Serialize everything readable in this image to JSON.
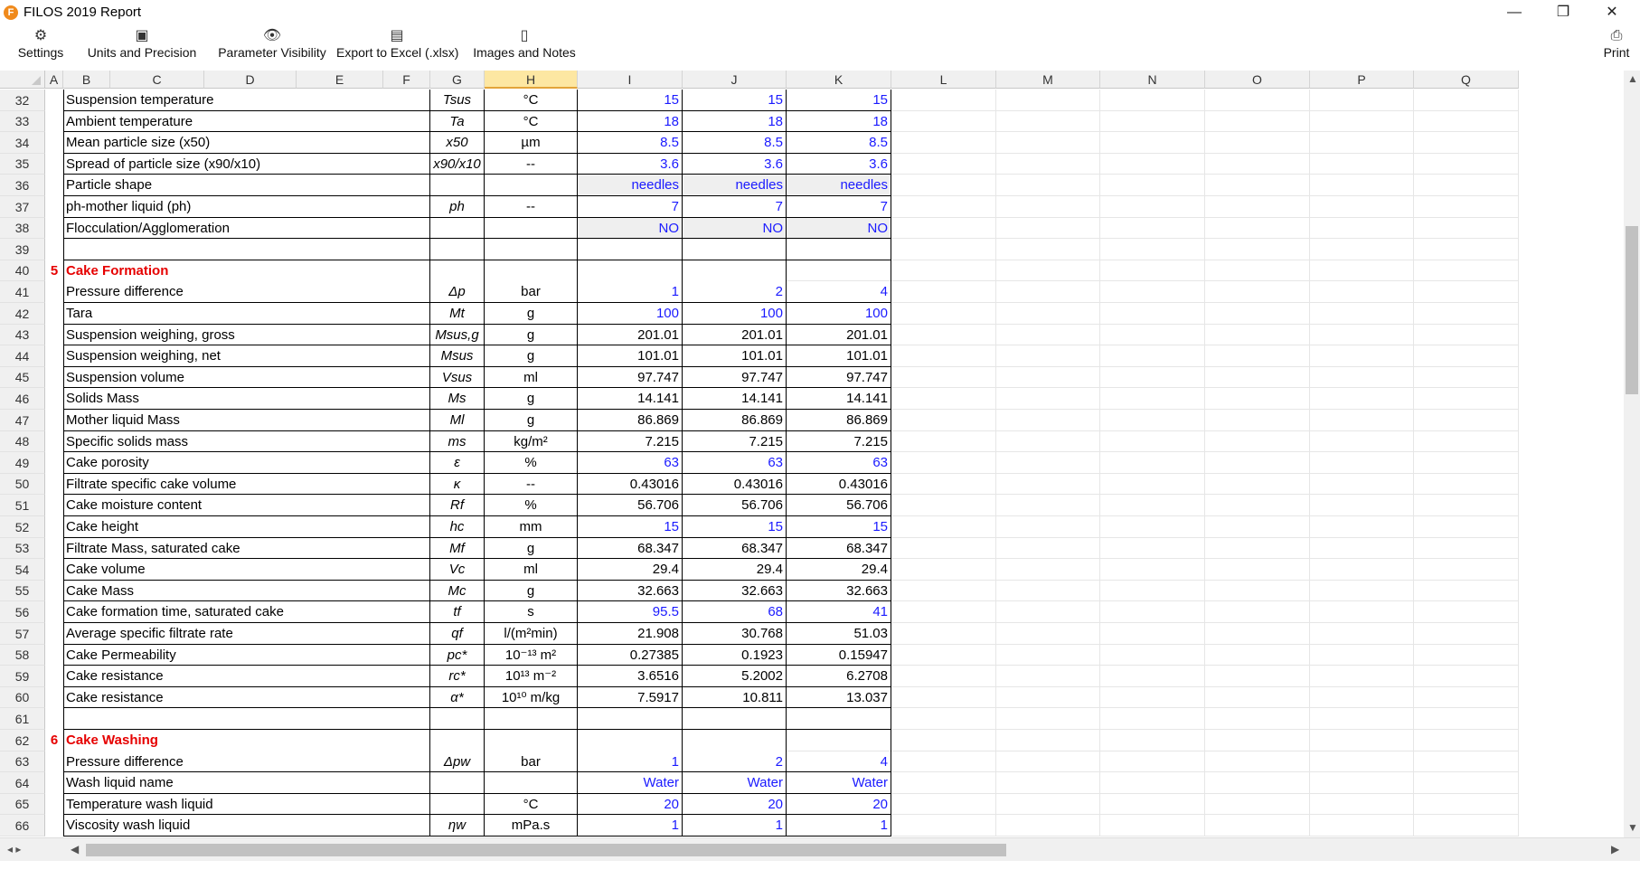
{
  "window": {
    "title": "FILOS 2019 Report",
    "logo_letter": "F",
    "minimize": "—",
    "restore": "❐",
    "close": "✕"
  },
  "toolbar": [
    {
      "name": "settings-button",
      "icon": "⚙",
      "label": "Settings"
    },
    {
      "name": "units-precision-button",
      "icon": "▣",
      "label": "Units and Precision"
    },
    {
      "name": "parameter-visibility-button",
      "icon": "👁",
      "label": "Parameter Visibility"
    },
    {
      "name": "export-excel-button",
      "icon": "▤",
      "label": "Export to Excel (.xlsx)"
    },
    {
      "name": "images-notes-button",
      "icon": "▯",
      "label": "Images and Notes"
    },
    {
      "name": "print-button",
      "icon": "⎙",
      "label": "Print"
    }
  ],
  "columns": [
    "A",
    "B",
    "C",
    "D",
    "E",
    "F",
    "G",
    "H",
    "I",
    "J",
    "K",
    "L",
    "M",
    "N",
    "O",
    "P",
    "Q"
  ],
  "selected_column": "H",
  "rows": [
    {
      "n": "32",
      "name": "Suspension temperature",
      "sym": "Tsus",
      "unit": "°C",
      "v": [
        "15",
        "15",
        "15"
      ],
      "blue": true
    },
    {
      "n": "33",
      "name": "Ambient temperature",
      "sym": "Ta",
      "unit": "°C",
      "v": [
        "18",
        "18",
        "18"
      ],
      "blue": true
    },
    {
      "n": "34",
      "name": "Mean particle size (x50)",
      "sym": "x50",
      "unit": "µm",
      "v": [
        "8.5",
        "8.5",
        "8.5"
      ],
      "blue": true
    },
    {
      "n": "35",
      "name": "Spread of particle size (x90/x10)",
      "sym": "x90/x10",
      "unit": "--",
      "v": [
        "3.6",
        "3.6",
        "3.6"
      ],
      "blue": true
    },
    {
      "n": "36",
      "name": "Particle shape",
      "sym": "",
      "unit": "",
      "v": [
        "needles",
        "needles",
        "needles"
      ],
      "blue": true,
      "shade": true
    },
    {
      "n": "37",
      "name": "ph-mother liquid (ph)",
      "sym": "ph",
      "unit": "--",
      "v": [
        "7",
        "7",
        "7"
      ],
      "blue": true
    },
    {
      "n": "38",
      "name": "Flocculation/Agglomeration",
      "sym": "",
      "unit": "",
      "v": [
        "NO",
        "NO",
        "NO"
      ],
      "blue": true,
      "shade": true
    },
    {
      "n": "39",
      "name": "",
      "sym": "",
      "unit": "",
      "v": [
        "",
        "",
        ""
      ]
    },
    {
      "n": "40",
      "num": "5",
      "section": "Cake Formation",
      "v": [
        "",
        "",
        ""
      ]
    },
    {
      "n": "41",
      "name": "Pressure difference",
      "sym": "Δp",
      "unit": "bar",
      "v": [
        "1",
        "2",
        "4"
      ],
      "blue": true
    },
    {
      "n": "42",
      "name": "Tara",
      "sym": "Mt",
      "unit": "g",
      "v": [
        "100",
        "100",
        "100"
      ],
      "blue": true
    },
    {
      "n": "43",
      "name": "Suspension weighing, gross",
      "sym": "Msus,g",
      "unit": "g",
      "v": [
        "201.01",
        "201.01",
        "201.01"
      ]
    },
    {
      "n": "44",
      "name": "Suspension weighing, net",
      "sym": "Msus",
      "unit": "g",
      "v": [
        "101.01",
        "101.01",
        "101.01"
      ]
    },
    {
      "n": "45",
      "name": "Suspension volume",
      "sym": "Vsus",
      "unit": "ml",
      "v": [
        "97.747",
        "97.747",
        "97.747"
      ]
    },
    {
      "n": "46",
      "name": "Solids Mass",
      "sym": "Ms",
      "unit": "g",
      "v": [
        "14.141",
        "14.141",
        "14.141"
      ]
    },
    {
      "n": "47",
      "name": "Mother liquid Mass",
      "sym": "Ml",
      "unit": "g",
      "v": [
        "86.869",
        "86.869",
        "86.869"
      ]
    },
    {
      "n": "48",
      "name": "Specific solids mass",
      "sym": "ms",
      "unit": "kg/m²",
      "v": [
        "7.215",
        "7.215",
        "7.215"
      ]
    },
    {
      "n": "49",
      "name": "Cake porosity",
      "sym": "ε",
      "unit": "%",
      "v": [
        "63",
        "63",
        "63"
      ],
      "blue": true
    },
    {
      "n": "50",
      "name": "Filtrate specific cake volume",
      "sym": "κ",
      "unit": "--",
      "v": [
        "0.43016",
        "0.43016",
        "0.43016"
      ]
    },
    {
      "n": "51",
      "name": "Cake moisture content",
      "sym": "Rf",
      "unit": "%",
      "v": [
        "56.706",
        "56.706",
        "56.706"
      ]
    },
    {
      "n": "52",
      "name": "Cake height",
      "sym": "hc",
      "unit": "mm",
      "v": [
        "15",
        "15",
        "15"
      ],
      "blue": true
    },
    {
      "n": "53",
      "name": "Filtrate Mass, saturated cake",
      "sym": "Mf",
      "unit": "g",
      "v": [
        "68.347",
        "68.347",
        "68.347"
      ]
    },
    {
      "n": "54",
      "name": "Cake volume",
      "sym": "Vc",
      "unit": "ml",
      "v": [
        "29.4",
        "29.4",
        "29.4"
      ]
    },
    {
      "n": "55",
      "name": "Cake Mass",
      "sym": "Mc",
      "unit": "g",
      "v": [
        "32.663",
        "32.663",
        "32.663"
      ]
    },
    {
      "n": "56",
      "name": "Cake formation time, saturated cake",
      "sym": "tf",
      "unit": "s",
      "v": [
        "95.5",
        "68",
        "41"
      ],
      "blue": true
    },
    {
      "n": "57",
      "name": "Average specific filtrate rate",
      "sym": "qf",
      "unit": "l/(m²min)",
      "v": [
        "21.908",
        "30.768",
        "51.03"
      ]
    },
    {
      "n": "58",
      "name": "Cake Permeability",
      "sym": "pc*",
      "unit": "10⁻¹³ m²",
      "v": [
        "0.27385",
        "0.1923",
        "0.15947"
      ]
    },
    {
      "n": "59",
      "name": "Cake resistance",
      "sym": "rc*",
      "unit": "10¹³ m⁻²",
      "v": [
        "3.6516",
        "5.2002",
        "6.2708"
      ]
    },
    {
      "n": "60",
      "name": "Cake resistance",
      "sym": "α*",
      "unit": "10¹⁰ m/kg",
      "v": [
        "7.5917",
        "10.811",
        "13.037"
      ]
    },
    {
      "n": "61",
      "name": "",
      "sym": "",
      "unit": "",
      "v": [
        "",
        "",
        ""
      ]
    },
    {
      "n": "62",
      "num": "6",
      "section": "Cake Washing",
      "v": [
        "",
        "",
        ""
      ]
    },
    {
      "n": "63",
      "name": "Pressure difference",
      "sym": "Δpw",
      "unit": "bar",
      "v": [
        "1",
        "2",
        "4"
      ],
      "blue": true
    },
    {
      "n": "64",
      "name": "Wash liquid name",
      "sym": "",
      "unit": "",
      "v": [
        "Water",
        "Water",
        "Water"
      ],
      "blue": true
    },
    {
      "n": "65",
      "name": "Temperature wash liquid",
      "sym": "",
      "unit": "°C",
      "v": [
        "20",
        "20",
        "20"
      ],
      "blue": true
    },
    {
      "n": "66",
      "name": "Viscosity wash liquid",
      "sym": "ηw",
      "unit": "mPa.s",
      "v": [
        "1",
        "1",
        "1"
      ],
      "blue": true
    }
  ],
  "colors": {
    "blue_value": "#1a1aff",
    "section_red": "#e60000",
    "selected_header": "#fde7a2"
  }
}
